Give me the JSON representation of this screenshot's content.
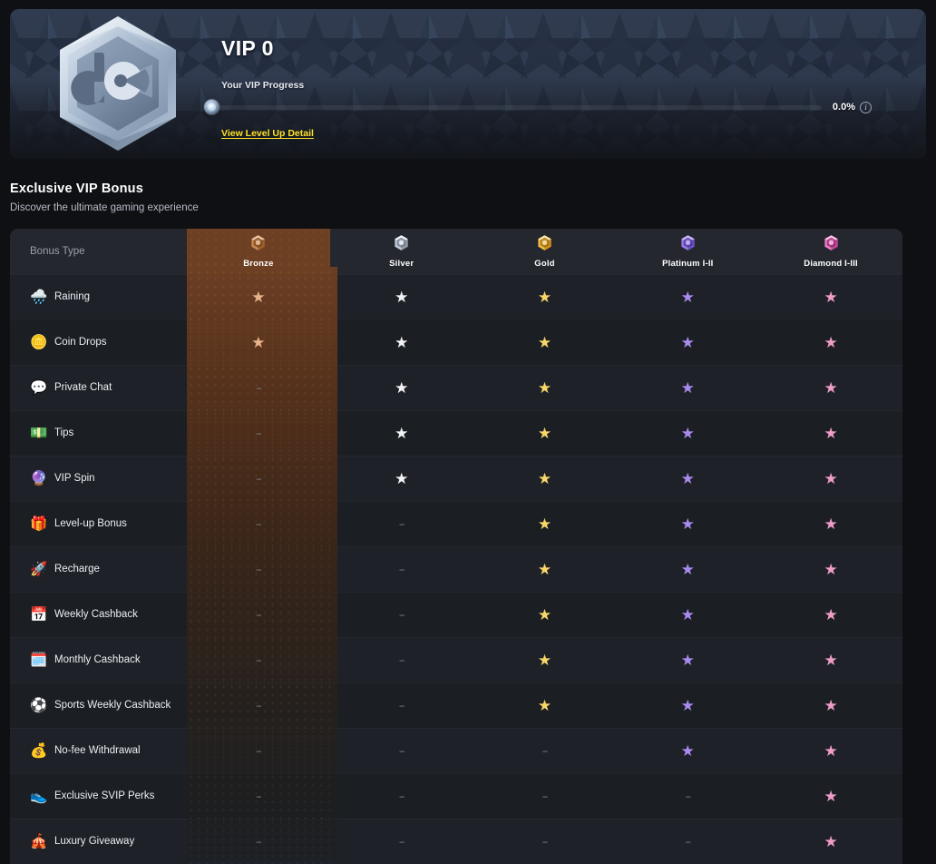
{
  "banner": {
    "vip_title": "VIP 0",
    "progress_label": "Your VIP Progress",
    "progress_percent": "0.0%",
    "info_icon": "info-icon",
    "level_link": "View Level Up Detail",
    "badge_icon": "vip-hex-badge-icon"
  },
  "section": {
    "title": "Exclusive VIP Bonus",
    "subtitle": "Discover the ultimate gaming experience"
  },
  "table": {
    "first_column_header": "Bonus Type",
    "tiers": [
      {
        "name": "Bronze",
        "icon": "bronze-medal-icon",
        "star_color": "#e8b48c",
        "highlight": true
      },
      {
        "name": "Silver",
        "icon": "silver-medal-icon",
        "star_color": "#f3f3f3",
        "highlight": false
      },
      {
        "name": "Gold",
        "icon": "gold-medal-icon",
        "star_color": "#f8d76a",
        "highlight": false
      },
      {
        "name": "Platinum I-II",
        "icon": "platinum-medal-icon",
        "star_color": "#a98bf0",
        "highlight": false
      },
      {
        "name": "Diamond I-III",
        "icon": "diamond-medal-icon",
        "star_color": "#ef9cc8",
        "highlight": false
      }
    ],
    "dash": "--",
    "star_glyph": "★",
    "rows": [
      {
        "label": "Raining",
        "emoji": "🌧️",
        "icon": "rain-cloud-icon",
        "values": [
          true,
          true,
          true,
          true,
          true
        ]
      },
      {
        "label": "Coin Drops",
        "emoji": "🪙",
        "icon": "coin-icon",
        "values": [
          true,
          true,
          true,
          true,
          true
        ]
      },
      {
        "label": "Private Chat",
        "emoji": "💬",
        "icon": "chat-bubble-icon",
        "values": [
          false,
          true,
          true,
          true,
          true
        ]
      },
      {
        "label": "Tips",
        "emoji": "💵",
        "icon": "money-note-icon",
        "values": [
          false,
          true,
          true,
          true,
          true
        ]
      },
      {
        "label": "VIP Spin",
        "emoji": "🔮",
        "icon": "crystal-ball-icon",
        "values": [
          false,
          true,
          true,
          true,
          true
        ]
      },
      {
        "label": "Level-up Bonus",
        "emoji": "🎁",
        "icon": "gift-icon",
        "values": [
          false,
          false,
          true,
          true,
          true
        ]
      },
      {
        "label": "Recharge",
        "emoji": "🚀",
        "icon": "rocket-icon",
        "values": [
          false,
          false,
          true,
          true,
          true
        ]
      },
      {
        "label": "Weekly Cashback",
        "emoji": "📅",
        "icon": "calendar-icon",
        "values": [
          false,
          false,
          true,
          true,
          true
        ]
      },
      {
        "label": "Monthly Cashback",
        "emoji": "🗓️",
        "icon": "calendar-month-icon",
        "values": [
          false,
          false,
          true,
          true,
          true
        ]
      },
      {
        "label": "Sports Weekly Cashback",
        "emoji": "⚽",
        "icon": "soccer-ball-icon",
        "values": [
          false,
          false,
          true,
          true,
          true
        ]
      },
      {
        "label": "No-fee Withdrawal",
        "emoji": "💰",
        "icon": "money-bag-icon",
        "values": [
          false,
          false,
          false,
          true,
          true
        ]
      },
      {
        "label": "Exclusive SVIP Perks",
        "emoji": "👟",
        "icon": "sneaker-icon",
        "values": [
          false,
          false,
          false,
          false,
          true
        ]
      },
      {
        "label": "Luxury Giveaway",
        "emoji": "🎪",
        "icon": "gift-box-icon",
        "values": [
          false,
          false,
          false,
          false,
          true
        ]
      }
    ]
  },
  "colors": {
    "page_background": "#0e1013",
    "table_background": "#1b1e23",
    "header_background": "#24272d",
    "bronze_highlight": "#6e4023",
    "link_yellow": "#ffe227",
    "text_primary": "#eceff4",
    "text_muted": "#9aa1ad"
  }
}
